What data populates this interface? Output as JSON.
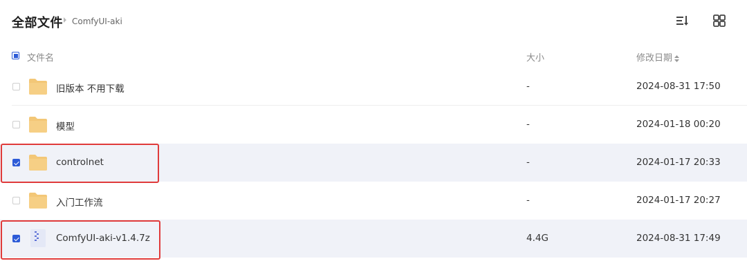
{
  "breadcrumb": {
    "root": "全部文件",
    "current": "ComfyUI-aki"
  },
  "toolbar": {
    "sort_icon": "sort-list-icon",
    "view_icon": "grid-view-icon"
  },
  "columns": {
    "name": "文件名",
    "size": "大小",
    "modified": "修改日期"
  },
  "files": [
    {
      "name": "旧版本 不用下载",
      "size": "-",
      "modified": "2024-08-31 17:50",
      "type": "folder",
      "selected": false
    },
    {
      "name": "模型",
      "size": "-",
      "modified": "2024-01-18 00:20",
      "type": "folder",
      "selected": false
    },
    {
      "name": "controlnet",
      "size": "-",
      "modified": "2024-01-17 20:33",
      "type": "folder",
      "selected": true
    },
    {
      "name": "入门工作流",
      "size": "-",
      "modified": "2024-01-17 20:27",
      "type": "folder",
      "selected": false
    },
    {
      "name": "ComfyUI-aki-v1.4.7z",
      "size": "4.4G",
      "modified": "2024-08-31 17:49",
      "type": "archive",
      "selected": true
    }
  ],
  "colors": {
    "accent": "#2d5bd7",
    "selected_row": "#f0f2f8",
    "folder": "#f3c777",
    "highlight": "#e03a3a"
  }
}
